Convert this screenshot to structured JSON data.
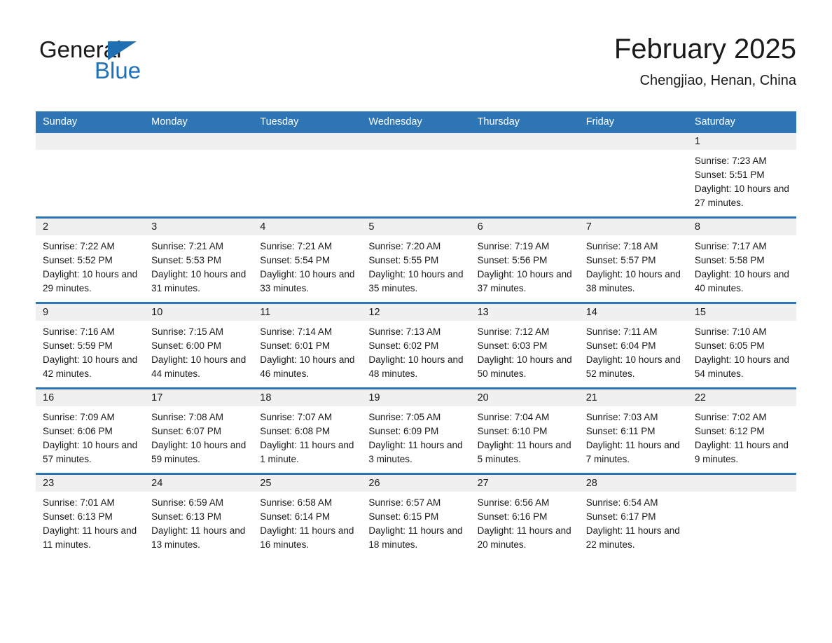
{
  "brand": {
    "name_part1": "General",
    "name_part2": "Blue"
  },
  "header": {
    "title": "February 2025",
    "location": "Chengjiao, Henan, China"
  },
  "colors": {
    "header_blue": "#2e75b6",
    "brand_blue": "#1f71b8",
    "daynum_band": "#f0f0f0",
    "text": "#1a1a1a"
  },
  "weekday_headers": [
    "Sunday",
    "Monday",
    "Tuesday",
    "Wednesday",
    "Thursday",
    "Friday",
    "Saturday"
  ],
  "weeks": [
    [
      {
        "day": "",
        "sunrise": "",
        "sunset": "",
        "daylight": "",
        "empty": true
      },
      {
        "day": "",
        "sunrise": "",
        "sunset": "",
        "daylight": "",
        "empty": true
      },
      {
        "day": "",
        "sunrise": "",
        "sunset": "",
        "daylight": "",
        "empty": true
      },
      {
        "day": "",
        "sunrise": "",
        "sunset": "",
        "daylight": "",
        "empty": true
      },
      {
        "day": "",
        "sunrise": "",
        "sunset": "",
        "daylight": "",
        "empty": true
      },
      {
        "day": "",
        "sunrise": "",
        "sunset": "",
        "daylight": "",
        "empty": true
      },
      {
        "day": "1",
        "sunrise": "Sunrise: 7:23 AM",
        "sunset": "Sunset: 5:51 PM",
        "daylight": "Daylight: 10 hours and 27 minutes.",
        "empty": false
      }
    ],
    [
      {
        "day": "2",
        "sunrise": "Sunrise: 7:22 AM",
        "sunset": "Sunset: 5:52 PM",
        "daylight": "Daylight: 10 hours and 29 minutes.",
        "empty": false
      },
      {
        "day": "3",
        "sunrise": "Sunrise: 7:21 AM",
        "sunset": "Sunset: 5:53 PM",
        "daylight": "Daylight: 10 hours and 31 minutes.",
        "empty": false
      },
      {
        "day": "4",
        "sunrise": "Sunrise: 7:21 AM",
        "sunset": "Sunset: 5:54 PM",
        "daylight": "Daylight: 10 hours and 33 minutes.",
        "empty": false
      },
      {
        "day": "5",
        "sunrise": "Sunrise: 7:20 AM",
        "sunset": "Sunset: 5:55 PM",
        "daylight": "Daylight: 10 hours and 35 minutes.",
        "empty": false
      },
      {
        "day": "6",
        "sunrise": "Sunrise: 7:19 AM",
        "sunset": "Sunset: 5:56 PM",
        "daylight": "Daylight: 10 hours and 37 minutes.",
        "empty": false
      },
      {
        "day": "7",
        "sunrise": "Sunrise: 7:18 AM",
        "sunset": "Sunset: 5:57 PM",
        "daylight": "Daylight: 10 hours and 38 minutes.",
        "empty": false
      },
      {
        "day": "8",
        "sunrise": "Sunrise: 7:17 AM",
        "sunset": "Sunset: 5:58 PM",
        "daylight": "Daylight: 10 hours and 40 minutes.",
        "empty": false
      }
    ],
    [
      {
        "day": "9",
        "sunrise": "Sunrise: 7:16 AM",
        "sunset": "Sunset: 5:59 PM",
        "daylight": "Daylight: 10 hours and 42 minutes.",
        "empty": false
      },
      {
        "day": "10",
        "sunrise": "Sunrise: 7:15 AM",
        "sunset": "Sunset: 6:00 PM",
        "daylight": "Daylight: 10 hours and 44 minutes.",
        "empty": false
      },
      {
        "day": "11",
        "sunrise": "Sunrise: 7:14 AM",
        "sunset": "Sunset: 6:01 PM",
        "daylight": "Daylight: 10 hours and 46 minutes.",
        "empty": false
      },
      {
        "day": "12",
        "sunrise": "Sunrise: 7:13 AM",
        "sunset": "Sunset: 6:02 PM",
        "daylight": "Daylight: 10 hours and 48 minutes.",
        "empty": false
      },
      {
        "day": "13",
        "sunrise": "Sunrise: 7:12 AM",
        "sunset": "Sunset: 6:03 PM",
        "daylight": "Daylight: 10 hours and 50 minutes.",
        "empty": false
      },
      {
        "day": "14",
        "sunrise": "Sunrise: 7:11 AM",
        "sunset": "Sunset: 6:04 PM",
        "daylight": "Daylight: 10 hours and 52 minutes.",
        "empty": false
      },
      {
        "day": "15",
        "sunrise": "Sunrise: 7:10 AM",
        "sunset": "Sunset: 6:05 PM",
        "daylight": "Daylight: 10 hours and 54 minutes.",
        "empty": false
      }
    ],
    [
      {
        "day": "16",
        "sunrise": "Sunrise: 7:09 AM",
        "sunset": "Sunset: 6:06 PM",
        "daylight": "Daylight: 10 hours and 57 minutes.",
        "empty": false
      },
      {
        "day": "17",
        "sunrise": "Sunrise: 7:08 AM",
        "sunset": "Sunset: 6:07 PM",
        "daylight": "Daylight: 10 hours and 59 minutes.",
        "empty": false
      },
      {
        "day": "18",
        "sunrise": "Sunrise: 7:07 AM",
        "sunset": "Sunset: 6:08 PM",
        "daylight": "Daylight: 11 hours and 1 minute.",
        "empty": false
      },
      {
        "day": "19",
        "sunrise": "Sunrise: 7:05 AM",
        "sunset": "Sunset: 6:09 PM",
        "daylight": "Daylight: 11 hours and 3 minutes.",
        "empty": false
      },
      {
        "day": "20",
        "sunrise": "Sunrise: 7:04 AM",
        "sunset": "Sunset: 6:10 PM",
        "daylight": "Daylight: 11 hours and 5 minutes.",
        "empty": false
      },
      {
        "day": "21",
        "sunrise": "Sunrise: 7:03 AM",
        "sunset": "Sunset: 6:11 PM",
        "daylight": "Daylight: 11 hours and 7 minutes.",
        "empty": false
      },
      {
        "day": "22",
        "sunrise": "Sunrise: 7:02 AM",
        "sunset": "Sunset: 6:12 PM",
        "daylight": "Daylight: 11 hours and 9 minutes.",
        "empty": false
      }
    ],
    [
      {
        "day": "23",
        "sunrise": "Sunrise: 7:01 AM",
        "sunset": "Sunset: 6:13 PM",
        "daylight": "Daylight: 11 hours and 11 minutes.",
        "empty": false
      },
      {
        "day": "24",
        "sunrise": "Sunrise: 6:59 AM",
        "sunset": "Sunset: 6:13 PM",
        "daylight": "Daylight: 11 hours and 13 minutes.",
        "empty": false
      },
      {
        "day": "25",
        "sunrise": "Sunrise: 6:58 AM",
        "sunset": "Sunset: 6:14 PM",
        "daylight": "Daylight: 11 hours and 16 minutes.",
        "empty": false
      },
      {
        "day": "26",
        "sunrise": "Sunrise: 6:57 AM",
        "sunset": "Sunset: 6:15 PM",
        "daylight": "Daylight: 11 hours and 18 minutes.",
        "empty": false
      },
      {
        "day": "27",
        "sunrise": "Sunrise: 6:56 AM",
        "sunset": "Sunset: 6:16 PM",
        "daylight": "Daylight: 11 hours and 20 minutes.",
        "empty": false
      },
      {
        "day": "28",
        "sunrise": "Sunrise: 6:54 AM",
        "sunset": "Sunset: 6:17 PM",
        "daylight": "Daylight: 11 hours and 22 minutes.",
        "empty": false
      },
      {
        "day": "",
        "sunrise": "",
        "sunset": "",
        "daylight": "",
        "empty": true
      }
    ]
  ]
}
